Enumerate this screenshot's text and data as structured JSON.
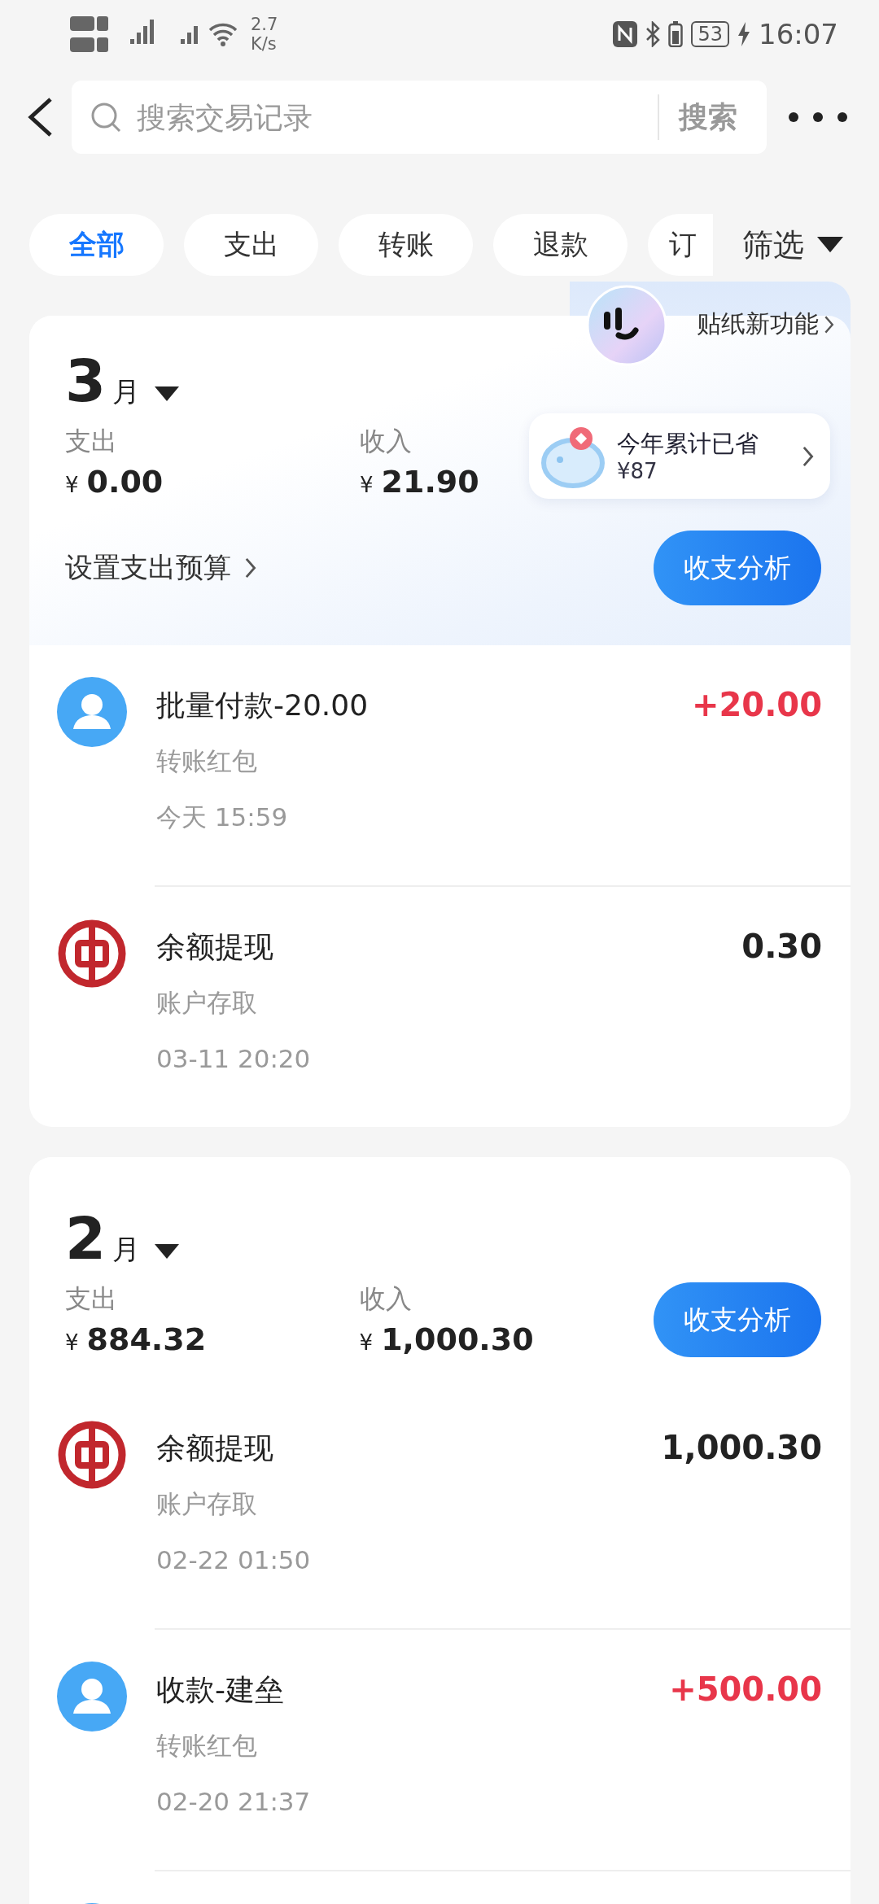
{
  "status_bar": {
    "speed": "2.7",
    "speed_unit": "K/s",
    "battery": "53",
    "time": "16:07"
  },
  "search": {
    "placeholder": "搜索交易记录",
    "button": "搜索"
  },
  "filters": [
    {
      "label": "全部",
      "selected": true
    },
    {
      "label": "支出",
      "selected": false
    },
    {
      "label": "转账",
      "selected": false
    },
    {
      "label": "退款",
      "selected": false
    },
    {
      "label": "订",
      "selected": false
    }
  ],
  "filter_button": "筛选",
  "sticker_promo": {
    "label": "贴纸新功能"
  },
  "savings": {
    "title": "今年累计已省",
    "amount": "¥87"
  },
  "months": [
    {
      "month": "3",
      "unit": "月",
      "highlighted": true,
      "expense_label": "支出",
      "expense": "0.00",
      "income_label": "收入",
      "income": "21.90",
      "currency": "¥",
      "budget_link": "设置支出预算",
      "analysis_button": "收支分析",
      "transactions": [
        {
          "kind": "person",
          "title": "批量付款-20.00",
          "category": "转账红包",
          "time": "今天 15:59",
          "amount": "+20.00",
          "incoming": true
        },
        {
          "kind": "bank",
          "title": "余额提现",
          "category": "账户存取",
          "time": "03-11 20:20",
          "amount": "0.30",
          "incoming": false
        }
      ]
    },
    {
      "month": "2",
      "unit": "月",
      "highlighted": false,
      "expense_label": "支出",
      "expense": "884.32",
      "income_label": "收入",
      "income": "1,000.30",
      "currency": "¥",
      "analysis_button": "收支分析",
      "transactions": [
        {
          "kind": "bank",
          "title": "余额提现",
          "category": "账户存取",
          "time": "02-22 01:50",
          "amount": "1,000.30",
          "incoming": false
        },
        {
          "kind": "person",
          "title": "收款-建垒",
          "category": "转账红包",
          "time": "02-20 21:37",
          "amount": "+500.00",
          "incoming": true
        },
        {
          "kind": "person"
        }
      ]
    }
  ]
}
